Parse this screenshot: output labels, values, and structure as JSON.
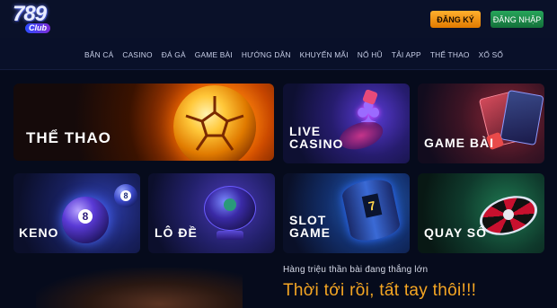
{
  "header": {
    "logo_number": "789",
    "logo_sub": "Club",
    "register_label": "ĐĂNG KÝ",
    "login_label": "ĐĂNG NHẬP"
  },
  "nav": {
    "items": [
      "BẮN CÁ",
      "CASINO",
      "ĐÁ GÀ",
      "GAME BÀI",
      "HƯỚNG DẪN",
      "KHUYẾN MÃI",
      "NỔ HŨ",
      "TẢI APP",
      "THỂ THAO",
      "XỔ SỐ"
    ]
  },
  "tiles": {
    "sport": "THỂ THAO",
    "casino": "LIVE\nCASINO",
    "gamebai": "GAME BÀI",
    "keno": "KENO",
    "lode": "LÔ ĐỀ",
    "slot": "SLOT\nGAME",
    "quayso": "QUAY SỐ"
  },
  "promo": {
    "subtitle": "Hàng triệu thần bài đang thắng lớn",
    "headline": "Thời tới rồi, tất tay thôi!!!"
  },
  "colors": {
    "background": "#060b1c",
    "accent_orange": "#f5a623",
    "register_button": "#e07a00",
    "login_button": "#27a55a"
  }
}
